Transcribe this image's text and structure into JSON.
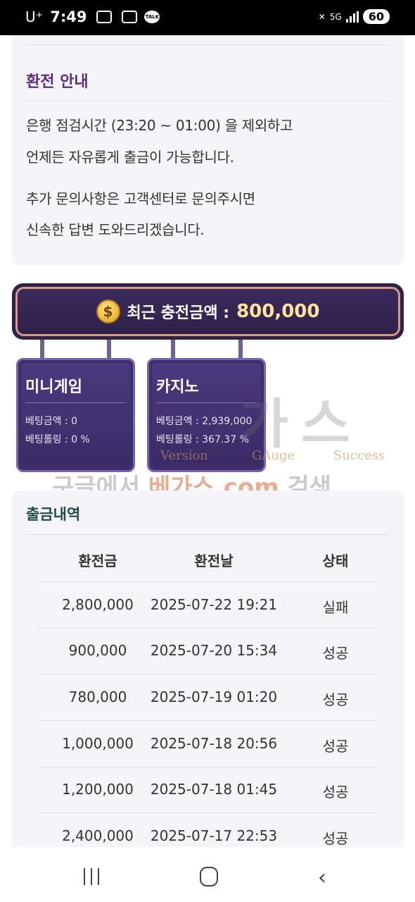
{
  "status_bar": {
    "carrier": "U⁺",
    "time": "7:49",
    "talk": "TALK",
    "network": "5G",
    "battery": "60"
  },
  "info": {
    "title": "환전 안내",
    "line1": "은행 점검시간 (23:20 ~ 01:00) 을 제외하고",
    "line2": "언제든 자유롭게 출금이 가능합니다.",
    "line3": "추가 문의사항은 고객센터로 문의주시면",
    "line4": "신속한 답변 도와드리겠습니다."
  },
  "recent_charge": {
    "coin": "$",
    "label": "최근 충전금액 :",
    "value": "800,000"
  },
  "games": [
    {
      "title": "미니게임",
      "bet_amount": "베팅금액 : 0",
      "rolling": "베팅롤링 : 0 %"
    },
    {
      "title": "카지노",
      "bet_amount": "베팅금액 : 2,939,000",
      "rolling": "베팅롤링 : 367.37 %"
    }
  ],
  "watermark": {
    "big": "가스",
    "version": "Version",
    "gauge": "GAuge",
    "success": "Success",
    "banner_pre": "구글에서 ",
    "banner_hl": "베가스.com",
    "banner_post": " 검색"
  },
  "withdraw": {
    "title": "출금내역",
    "headers": [
      "환전금",
      "환전날",
      "상태"
    ],
    "rows": [
      {
        "amount": "2,800,000",
        "date": "2025-07-22 19:21",
        "status": "실패"
      },
      {
        "amount": "900,000",
        "date": "2025-07-20 15:34",
        "status": "성공"
      },
      {
        "amount": "780,000",
        "date": "2025-07-19 01:20",
        "status": "성공"
      },
      {
        "amount": "1,000,000",
        "date": "2025-07-18 20:56",
        "status": "성공"
      },
      {
        "amount": "1,200,000",
        "date": "2025-07-18 01:45",
        "status": "성공"
      },
      {
        "amount": "2,400,000",
        "date": "2025-07-17 22:53",
        "status": "성공"
      }
    ]
  },
  "nav": {
    "back": "‹"
  }
}
